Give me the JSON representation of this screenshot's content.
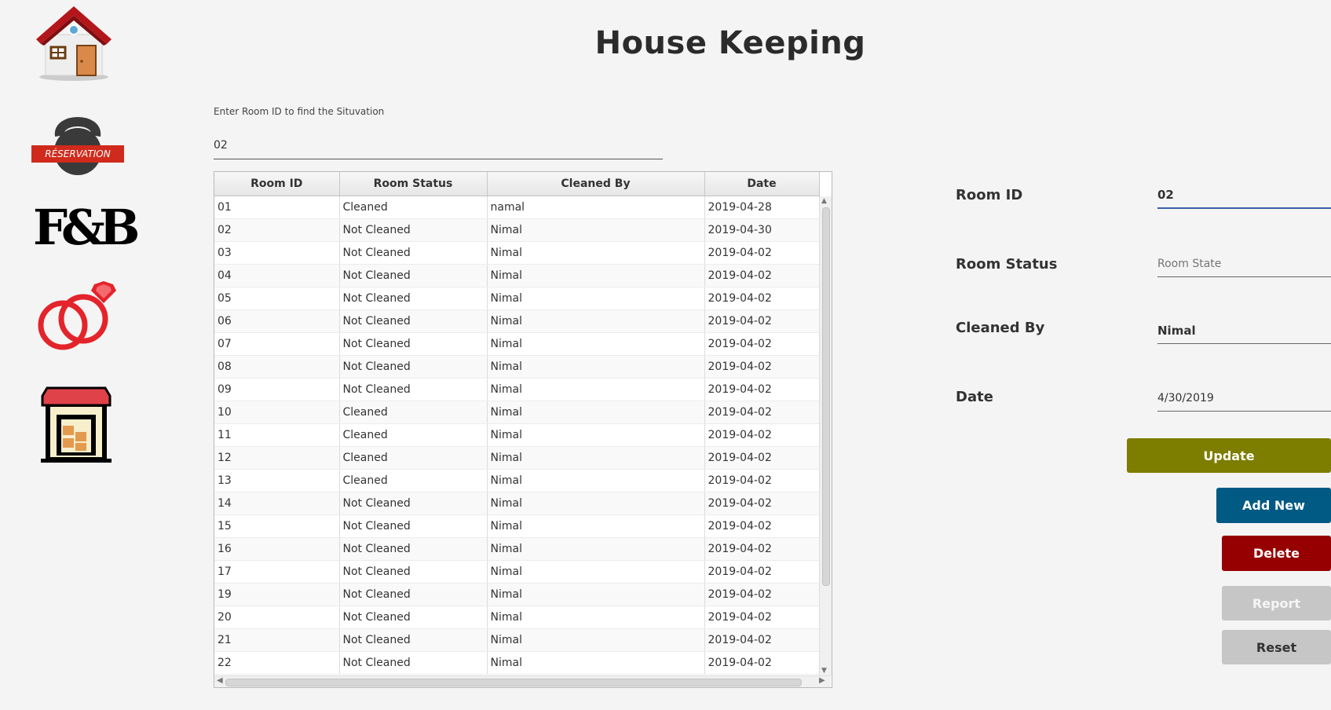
{
  "title": "House Keeping",
  "sidebar": {
    "home": "home-icon",
    "reservation": {
      "icon": "kettlebell-icon",
      "label": "RÉSERVATION"
    },
    "fnb": {
      "icon": "fnb-icon",
      "label": "F&B"
    },
    "wedding": "wedding-rings-icon",
    "store": "store-icon"
  },
  "search": {
    "label": "Enter Room ID to find the Situvation",
    "value": "02"
  },
  "table": {
    "columns": [
      "Room ID",
      "Room Status",
      "Cleaned By",
      "Date"
    ],
    "rows": [
      [
        "01",
        "Cleaned",
        "namal",
        "2019-04-28"
      ],
      [
        "02",
        "Not Cleaned",
        "Nimal",
        "2019-04-30"
      ],
      [
        "03",
        "Not Cleaned",
        "Nimal",
        "2019-04-02"
      ],
      [
        "04",
        "Not Cleaned",
        "Nimal",
        "2019-04-02"
      ],
      [
        "05",
        "Not Cleaned",
        "Nimal",
        "2019-04-02"
      ],
      [
        "06",
        "Not Cleaned",
        "Nimal",
        "2019-04-02"
      ],
      [
        "07",
        "Not Cleaned",
        "Nimal",
        "2019-04-02"
      ],
      [
        "08",
        "Not Cleaned",
        "Nimal",
        "2019-04-02"
      ],
      [
        "09",
        "Not Cleaned",
        "Nimal",
        "2019-04-02"
      ],
      [
        "10",
        "Cleaned",
        "Nimal",
        "2019-04-02"
      ],
      [
        "11",
        "Cleaned",
        "Nimal",
        "2019-04-02"
      ],
      [
        "12",
        "Cleaned",
        "Nimal",
        "2019-04-02"
      ],
      [
        "13",
        "Cleaned",
        "Nimal",
        "2019-04-02"
      ],
      [
        "14",
        "Not Cleaned",
        "Nimal",
        "2019-04-02"
      ],
      [
        "15",
        "Not Cleaned",
        "Nimal",
        "2019-04-02"
      ],
      [
        "16",
        "Not Cleaned",
        "Nimal",
        "2019-04-02"
      ],
      [
        "17",
        "Not Cleaned",
        "Nimal",
        "2019-04-02"
      ],
      [
        "19",
        "Not Cleaned",
        "Nimal",
        "2019-04-02"
      ],
      [
        "20",
        "Not Cleaned",
        "Nimal",
        "2019-04-02"
      ],
      [
        "21",
        "Not Cleaned",
        "Nimal",
        "2019-04-02"
      ],
      [
        "22",
        "Not Cleaned",
        "Nimal",
        "2019-04-02"
      ]
    ]
  },
  "form": {
    "room_id": {
      "label": "Room ID",
      "value": "02"
    },
    "room_status": {
      "label": "Room Status",
      "placeholder": "Room State",
      "value": ""
    },
    "cleaned_by": {
      "label": "Cleaned By",
      "value": "Nimal"
    },
    "date": {
      "label": "Date",
      "value": "4/30/2019"
    }
  },
  "buttons": {
    "update": "Update",
    "add_new": "Add New",
    "delete": "Delete",
    "report": "Report",
    "reset": "Reset"
  },
  "colors": {
    "update": "#7d7d00",
    "add_new": "#005a84",
    "delete": "#960000",
    "disabled": "#c6c6c6"
  }
}
